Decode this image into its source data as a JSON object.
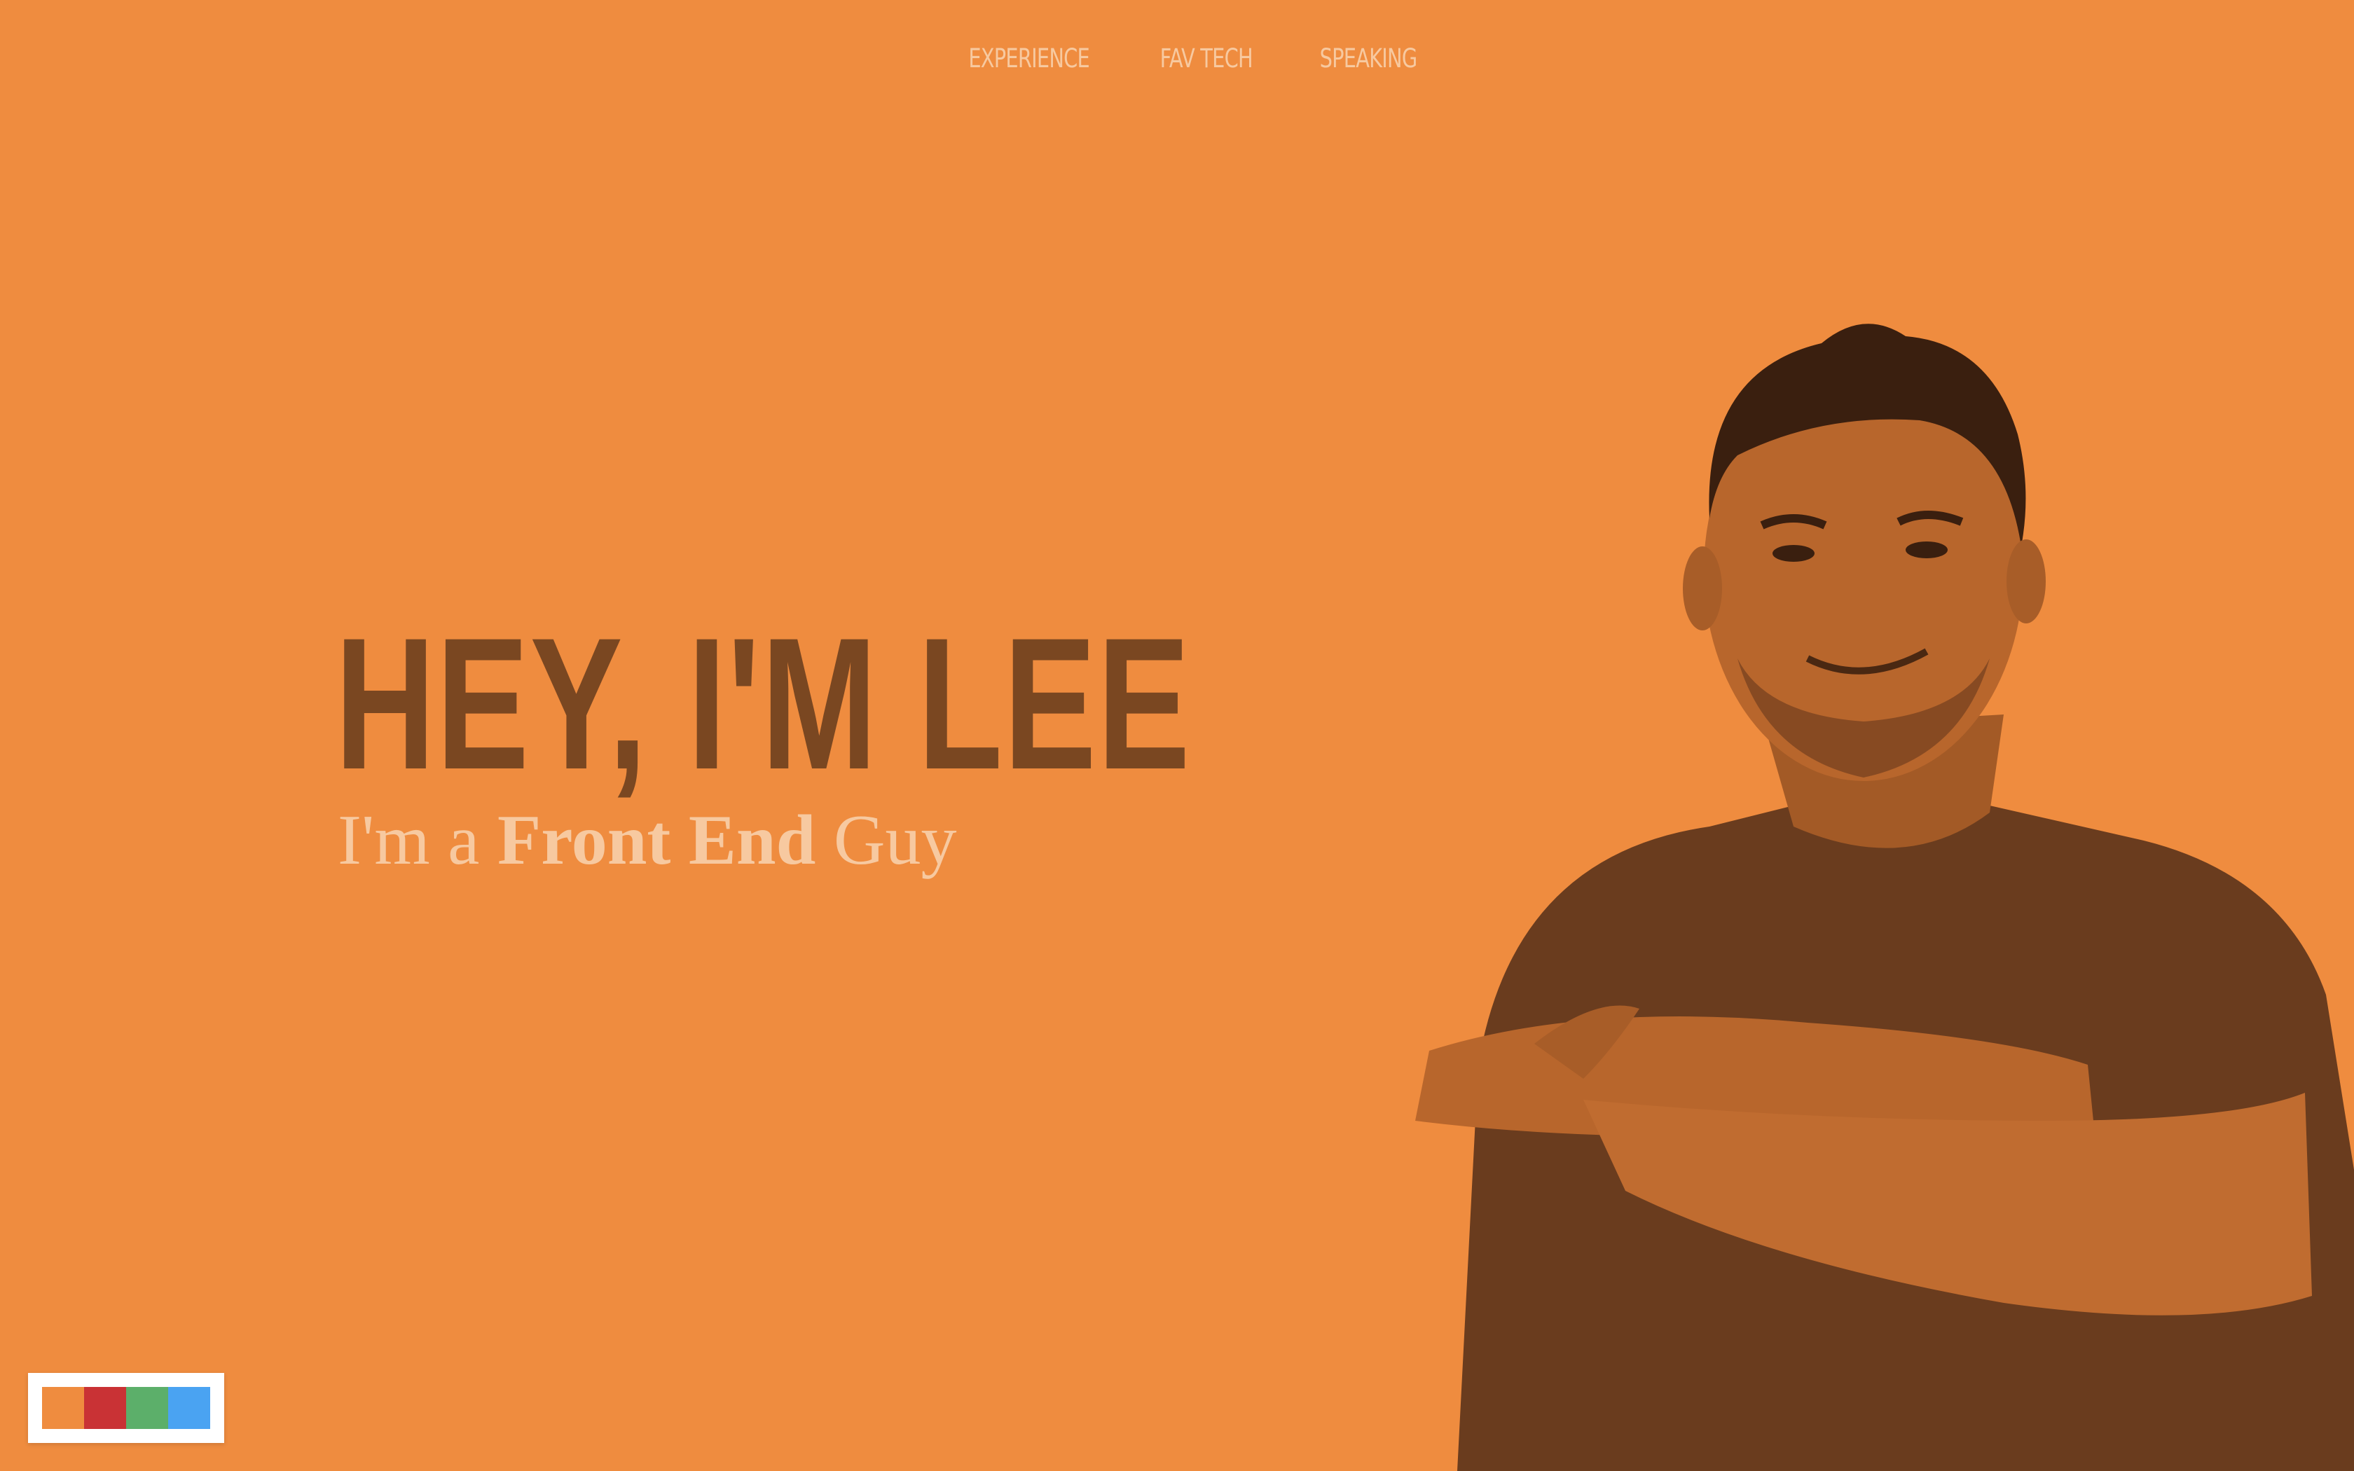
{
  "nav": {
    "items": [
      {
        "label": "EXPERIENCE"
      },
      {
        "label": "FAV TECH"
      },
      {
        "label": "SPEAKING"
      }
    ]
  },
  "hero": {
    "title": "HEY, I'M LEE",
    "tagline_prefix": "I'm a ",
    "tagline_emphasis": "Front End",
    "tagline_suffix": " Guy"
  },
  "portrait": {
    "icon": "person-portrait"
  },
  "theme_switcher": {
    "swatches": [
      {
        "name": "orange",
        "color": "#ef8c3f"
      },
      {
        "name": "red",
        "color": "#c93235"
      },
      {
        "name": "green",
        "color": "#5caf6a"
      },
      {
        "name": "blue",
        "color": "#4aa3f2"
      }
    ]
  },
  "colors": {
    "background": "#ef8c3f",
    "title": "#7a4721",
    "light_text": "#f7c9a0"
  }
}
